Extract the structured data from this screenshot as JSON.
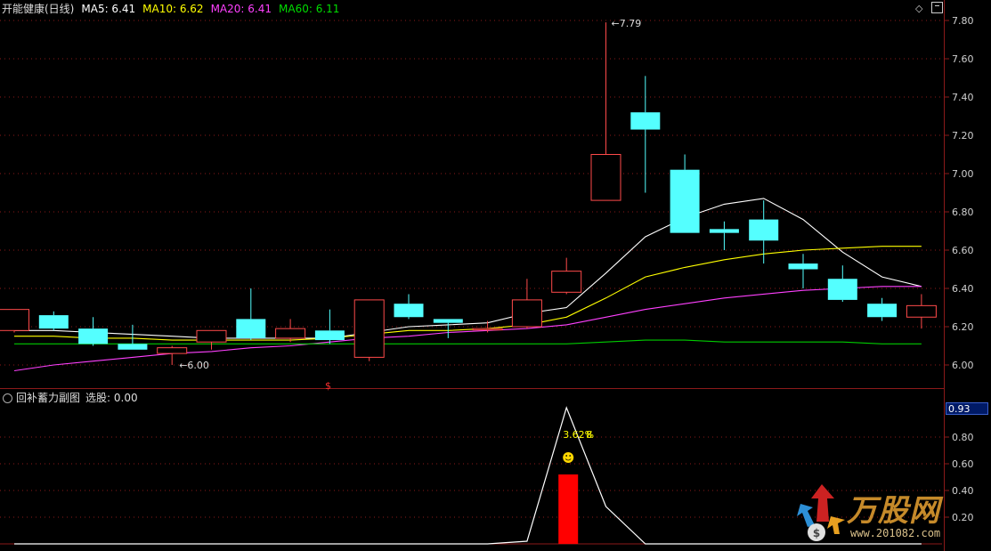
{
  "main_header": {
    "stock": "开能健康(日线)",
    "ma5_label": "MA5: 6.41",
    "ma10_label": "MA10: 6.62",
    "ma20_label": "MA20: 6.41",
    "ma60_label": "MA60: 6.11"
  },
  "sub_header": {
    "title": "回补蓄力副图",
    "pick_label": "选股: 0.00"
  },
  "colors": {
    "up": "#ff4a4a",
    "down": "#54ffff",
    "ma5": "#ffffff",
    "ma10": "#ffff00",
    "ma20": "#ff40ff",
    "ma60": "#00cc00",
    "grid": "#8b1a1a",
    "signal_bar": "#ff0000"
  },
  "icons": {
    "settings": "diamond-icon",
    "window": "square-icon",
    "smiley": "smiley-icon",
    "logo": "bull-logo-icon"
  },
  "sub_value_box": "0.93",
  "logo": {
    "brand": "万股网",
    "url": "www.201082.com"
  },
  "chart_data": [
    {
      "type": "candlestick",
      "title": "开能健康(日线)",
      "y_ticks": [
        "7.80",
        "7.60",
        "7.40",
        "7.20",
        "7.00",
        "6.80",
        "6.60",
        "6.40",
        "6.20",
        "6.00"
      ],
      "ylim": [
        5.88,
        7.84
      ],
      "grid": true,
      "annotations": {
        "high_label": "7.79",
        "low_label": "6.00",
        "marker": "$"
      },
      "candles": [
        {
          "open": 6.18,
          "close": 6.29,
          "high": 6.29,
          "low": 6.17
        },
        {
          "open": 6.26,
          "close": 6.19,
          "high": 6.28,
          "low": 6.18
        },
        {
          "open": 6.19,
          "close": 6.11,
          "high": 6.25,
          "low": 6.1
        },
        {
          "open": 6.11,
          "close": 6.08,
          "high": 6.21,
          "low": 6.08
        },
        {
          "open": 6.06,
          "close": 6.09,
          "high": 6.1,
          "low": 6.0
        },
        {
          "open": 6.12,
          "close": 6.18,
          "high": 6.18,
          "low": 6.08
        },
        {
          "open": 6.24,
          "close": 6.14,
          "high": 6.4,
          "low": 6.13
        },
        {
          "open": 6.14,
          "close": 6.19,
          "high": 6.24,
          "low": 6.12
        },
        {
          "open": 6.18,
          "close": 6.13,
          "high": 6.29,
          "low": 6.11
        },
        {
          "open": 6.04,
          "close": 6.34,
          "high": 6.34,
          "low": 6.02
        },
        {
          "open": 6.32,
          "close": 6.25,
          "high": 6.37,
          "low": 6.24
        },
        {
          "open": 6.24,
          "close": 6.22,
          "high": 6.24,
          "low": 6.14
        },
        {
          "open": 6.19,
          "close": 6.19,
          "high": 6.23,
          "low": 6.17
        },
        {
          "open": 6.2,
          "close": 6.34,
          "high": 6.45,
          "low": 6.19
        },
        {
          "open": 6.38,
          "close": 6.49,
          "high": 6.56,
          "low": 6.37
        },
        {
          "open": 6.86,
          "close": 7.1,
          "high": 7.79,
          "low": 6.86
        },
        {
          "open": 7.32,
          "close": 7.23,
          "high": 7.51,
          "low": 6.9
        },
        {
          "open": 7.02,
          "close": 6.69,
          "high": 7.1,
          "low": 6.69
        },
        {
          "open": 6.71,
          "close": 6.69,
          "high": 6.75,
          "low": 6.6
        },
        {
          "open": 6.76,
          "close": 6.65,
          "high": 6.86,
          "low": 6.53
        },
        {
          "open": 6.53,
          "close": 6.5,
          "high": 6.58,
          "low": 6.4
        },
        {
          "open": 6.45,
          "close": 6.34,
          "high": 6.52,
          "low": 6.33
        },
        {
          "open": 6.32,
          "close": 6.25,
          "high": 6.35,
          "low": 6.23
        },
        {
          "open": 6.25,
          "close": 6.31,
          "high": 6.37,
          "low": 6.19
        }
      ],
      "series": [
        {
          "name": "MA5",
          "values": [
            6.18,
            6.18,
            6.17,
            6.16,
            6.15,
            6.14,
            6.14,
            6.14,
            6.14,
            6.17,
            6.2,
            6.21,
            6.22,
            6.27,
            6.3,
            6.48,
            6.67,
            6.77,
            6.84,
            6.87,
            6.76,
            6.59,
            6.46,
            6.41
          ]
        },
        {
          "name": "MA10",
          "values": [
            6.15,
            6.15,
            6.14,
            6.14,
            6.13,
            6.13,
            6.13,
            6.13,
            6.14,
            6.16,
            6.18,
            6.18,
            6.19,
            6.21,
            6.25,
            6.35,
            6.46,
            6.51,
            6.55,
            6.58,
            6.6,
            6.61,
            6.62,
            6.62
          ]
        },
        {
          "name": "MA20",
          "values": [
            5.97,
            6.0,
            6.02,
            6.04,
            6.06,
            6.07,
            6.09,
            6.1,
            6.12,
            6.14,
            6.15,
            6.17,
            6.18,
            6.19,
            6.21,
            6.25,
            6.29,
            6.32,
            6.35,
            6.37,
            6.39,
            6.4,
            6.41,
            6.41
          ]
        },
        {
          "name": "MA60",
          "values": [
            6.11,
            6.11,
            6.11,
            6.11,
            6.11,
            6.11,
            6.11,
            6.11,
            6.11,
            6.11,
            6.11,
            6.11,
            6.11,
            6.11,
            6.11,
            6.12,
            6.13,
            6.13,
            6.12,
            6.12,
            6.12,
            6.12,
            6.11,
            6.11
          ]
        }
      ]
    },
    {
      "type": "bar",
      "title": "回补蓄力副图",
      "y_ticks": [
        "0.80",
        "0.60",
        "0.40",
        "0.20"
      ],
      "ylim": [
        0,
        1.05
      ],
      "grid": true,
      "line_values": [
        0,
        0,
        0,
        0,
        0,
        0,
        0,
        0,
        0,
        0,
        0,
        0,
        0,
        0.02,
        1.02,
        0.28,
        0,
        0,
        0,
        0,
        0,
        0,
        0,
        0
      ],
      "signal_bar": {
        "index": 14,
        "value": 0.52
      },
      "annotation": "3.62%",
      "annotation_overlay": "8"
    }
  ]
}
